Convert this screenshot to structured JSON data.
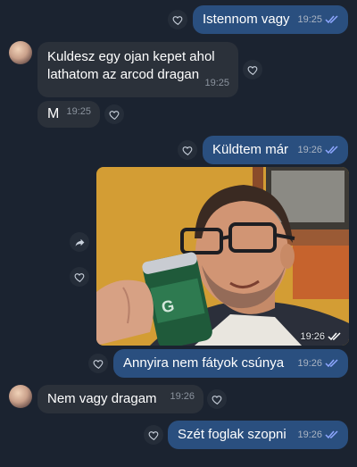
{
  "colors": {
    "background": "#1b2330",
    "outgoing_bubble": "#2a4f7f",
    "incoming_bubble": "#2b313a",
    "read_ticks": "#8ea7ff"
  },
  "messages": [
    {
      "text": "Istennom vagy",
      "time": "19:25",
      "direction": "outgoing",
      "icon": "double-check-icon"
    },
    {
      "text": "Kuldesz egy ojan kepet ahol lathatom az arcod dragan",
      "time": "19:25",
      "direction": "incoming"
    },
    {
      "text": "M",
      "time": "19:25",
      "direction": "incoming"
    },
    {
      "text": "Küldtem már",
      "time": "19:26",
      "direction": "outgoing",
      "icon": "double-check-icon"
    },
    {
      "type": "photo",
      "time": "19:26",
      "direction": "outgoing",
      "icon": "double-check-icon"
    },
    {
      "text": "Annyira nem fátyok csúnya",
      "time": "19:26",
      "direction": "outgoing",
      "icon": "double-check-icon"
    },
    {
      "text": "Nem vagy dragam",
      "time": "19:26",
      "direction": "incoming"
    },
    {
      "text": "Szét foglak szopni",
      "time": "19:26",
      "direction": "outgoing",
      "icon": "double-check-icon"
    }
  ]
}
